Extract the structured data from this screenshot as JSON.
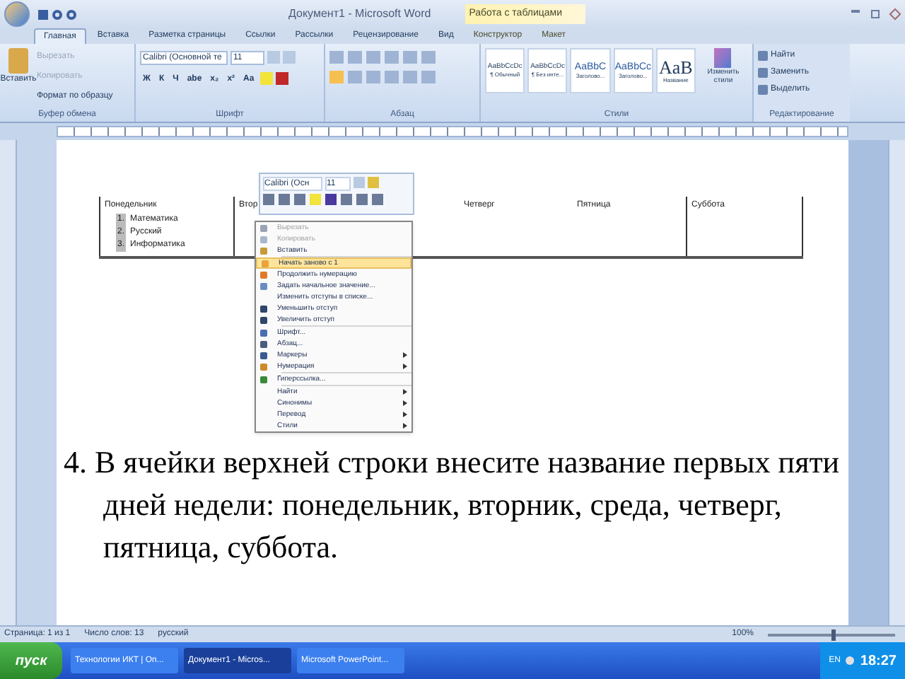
{
  "title_bar": {
    "title": "Документ1 - Microsoft Word",
    "context_tab": "Работа с таблицами"
  },
  "tabs": [
    {
      "label": "Главная",
      "selected": true
    },
    {
      "label": "Вставка",
      "selected": false
    },
    {
      "label": "Разметка страницы",
      "selected": false
    },
    {
      "label": "Ссылки",
      "selected": false
    },
    {
      "label": "Рассылки",
      "selected": false
    },
    {
      "label": "Рецензирование",
      "selected": false
    },
    {
      "label": "Вид",
      "selected": false
    },
    {
      "label": "Конструктор",
      "selected": false
    },
    {
      "label": "Макет",
      "selected": false
    }
  ],
  "ribbon": {
    "clipboard": {
      "label": "Буфер обмена",
      "paste": "Вставить",
      "items": [
        {
          "label": "Вырезать",
          "disabled": true
        },
        {
          "label": "Копировать",
          "disabled": true
        },
        {
          "label": "Формат по образцу",
          "disabled": false
        }
      ]
    },
    "font": {
      "label": "Шрифт",
      "font_name": "Calibri (Основной те",
      "font_size": "11",
      "buttons": [
        "Ж",
        "К",
        "Ч",
        "abe",
        "x₂",
        "x²",
        "Aa"
      ]
    },
    "paragraph": {
      "label": "Абзац"
    },
    "styles": {
      "label": "Стили",
      "items": [
        {
          "sample": "AaBbCcDc",
          "name": "¶ Обычный"
        },
        {
          "sample": "AaBbCcDc",
          "name": "¶ Без инте..."
        },
        {
          "sample": "AaBbC",
          "name": "Заголово..."
        },
        {
          "sample": "AaBbCc",
          "name": "Заголово..."
        },
        {
          "sample": "AaB",
          "name": "Название"
        }
      ],
      "change": "Изменить стили"
    },
    "editing": {
      "label": "Редактирование",
      "items": [
        "Найти",
        "Заменить",
        "Выделить"
      ]
    }
  },
  "table": {
    "header": [
      "Понедельник",
      "Втор",
      "Четверг",
      "Пятница",
      "Суббота"
    ],
    "list": [
      {
        "number": "1.",
        "text": "Математика"
      },
      {
        "number": "2.",
        "text": "Русский"
      },
      {
        "number": "3.",
        "text": "Информатика"
      }
    ]
  },
  "mini_toolbar": {
    "font_name": "Calibri (Осн",
    "font_size": "11"
  },
  "context_menu": [
    {
      "label": "Вырезать",
      "disabled": true,
      "selected": false,
      "submenu": false
    },
    {
      "label": "Копировать",
      "disabled": true,
      "selected": false,
      "submenu": false
    },
    {
      "label": "Вставить",
      "disabled": false,
      "selected": false,
      "submenu": false
    },
    {
      "label": "Начать заново с 1",
      "disabled": false,
      "selected": true,
      "submenu": false
    },
    {
      "label": "Продолжить нумерацию",
      "disabled": false,
      "selected": false,
      "submenu": false
    },
    {
      "label": "Задать начальное значение...",
      "disabled": false,
      "selected": false,
      "submenu": false
    },
    {
      "label": "Изменить отступы в списке...",
      "disabled": false,
      "selected": false,
      "submenu": false
    },
    {
      "label": "Уменьшить отступ",
      "disabled": false,
      "selected": false,
      "submenu": false
    },
    {
      "label": "Увеличить отступ",
      "disabled": false,
      "selected": false,
      "submenu": false
    },
    {
      "label": "Шрифт...",
      "disabled": false,
      "selected": false,
      "submenu": false
    },
    {
      "label": "Абзац...",
      "disabled": false,
      "selected": false,
      "submenu": false
    },
    {
      "label": "Маркеры",
      "disabled": false,
      "selected": false,
      "submenu": true
    },
    {
      "label": "Нумерация",
      "disabled": false,
      "selected": false,
      "submenu": true
    },
    {
      "label": "Гиперссылка...",
      "disabled": false,
      "selected": false,
      "submenu": false
    },
    {
      "label": "Найти",
      "disabled": false,
      "selected": false,
      "submenu": true
    },
    {
      "label": "Синонимы",
      "disabled": false,
      "selected": false,
      "submenu": true
    },
    {
      "label": "Перевод",
      "disabled": false,
      "selected": false,
      "submenu": true
    },
    {
      "label": "Стили",
      "disabled": false,
      "selected": false,
      "submenu": true
    }
  ],
  "slide_text": "4. В ячейки верхней строки внесите название первых пяти дней недели: понедельник, вторник, среда, четверг, пятница, суббота.",
  "status_bar": {
    "items": [
      "Страница: 1 из 1",
      "Число слов: 13",
      "русский"
    ],
    "zoom": "100%",
    "zoom_slider": {
      "level": 0.5
    }
  },
  "taskbar": {
    "start": "пуск",
    "items": [
      {
        "label": "Технологии ИКТ | Оп...",
        "selected": false
      },
      {
        "label": "Документ1 - Micros...",
        "selected": true
      },
      {
        "label": "Microsoft PowerPoint...",
        "selected": false
      }
    ],
    "language": "EN",
    "clock": "18:27"
  }
}
